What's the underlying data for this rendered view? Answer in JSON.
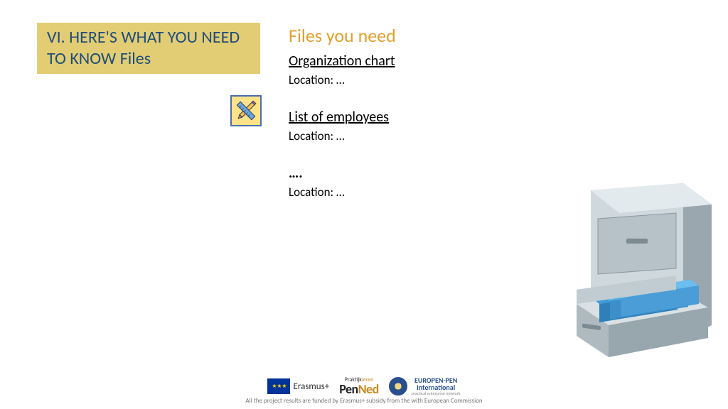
{
  "title": "VI. HERE'S WHAT YOU NEED TO KNOW Files",
  "content": {
    "heading": "Files you need",
    "files": [
      {
        "title": "Organization chart",
        "location": "Location: …"
      },
      {
        "title": "List of employees",
        "location": "Location: …"
      },
      {
        "title": "….",
        "location": "Location: …"
      }
    ]
  },
  "footer": {
    "erasmus": "Erasmus+",
    "penned_top_a": "Praktijk",
    "penned_top_b": "leren",
    "penned_a": "Pen",
    "penned_b": "Ned",
    "europen_line1": "EUROPEN-PEN",
    "europen_line2": "International",
    "europen_line3": "practical enterprise network",
    "disclaimer": "All the project results are funded by Erasmus+ subsidy from the with European Commission"
  }
}
